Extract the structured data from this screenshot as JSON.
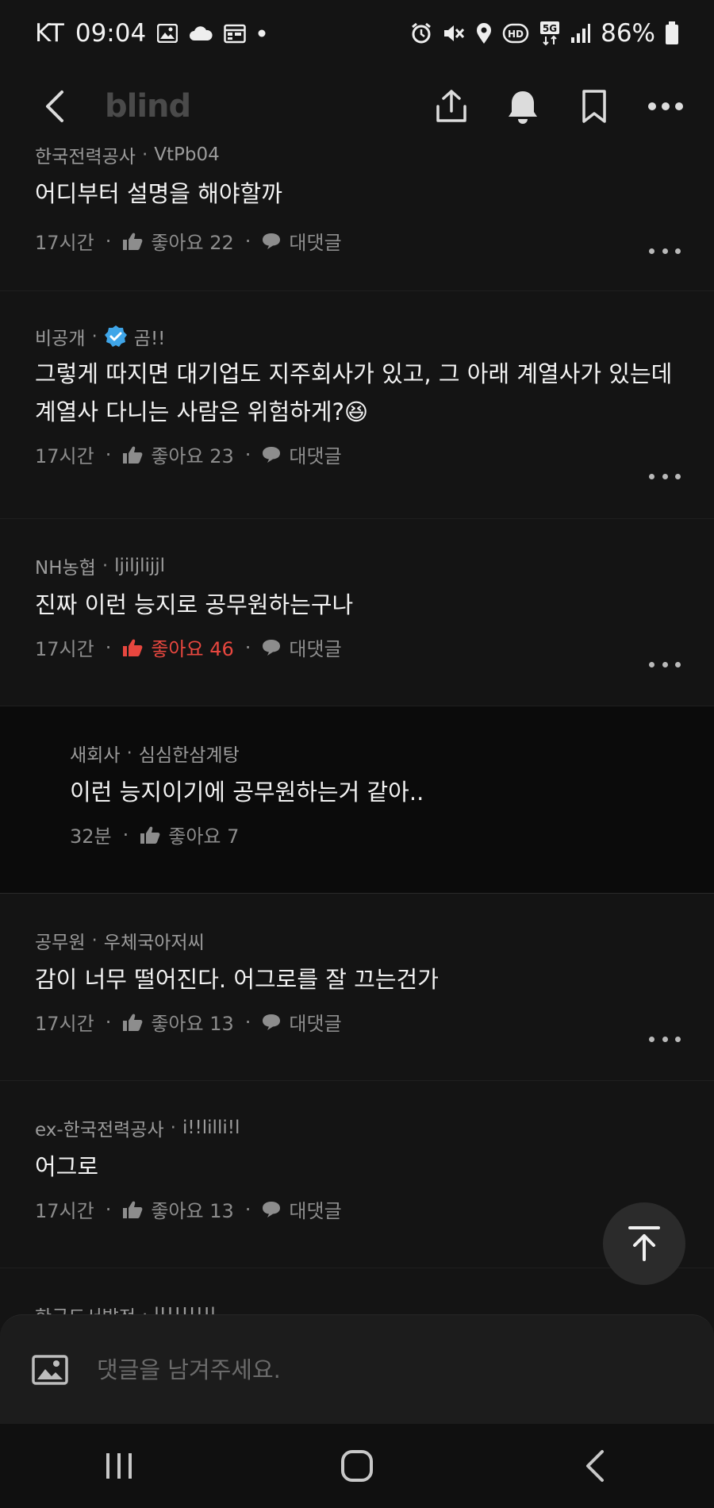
{
  "status": {
    "carrier": "KT",
    "time": "09:04",
    "network": "5G",
    "battery": "86%"
  },
  "header": {
    "logo": "blind"
  },
  "comments": [
    {
      "company": "한국전력공사",
      "nickname": "VtPb04",
      "text": "어디부터 설명을 해야할까",
      "time": "17시간",
      "like_label": "좋아요 22",
      "reply_label": "대댓글"
    },
    {
      "company": "비공개",
      "nickname": "곰!!",
      "text": "그렇게 따지면 대기업도 지주회사가 있고, 그 아래 계열사가 있는데 계열사 다니는 사람은 위험하게?😆",
      "time": "17시간",
      "like_label": "좋아요 23",
      "reply_label": "대댓글"
    },
    {
      "company": "NH농협",
      "nickname": "ljiljlijjl",
      "text": "진짜 이런 능지로 공무원하는구나",
      "time": "17시간",
      "like_label": "좋아요 46",
      "reply_label": "대댓글"
    },
    {
      "company": "새회사",
      "nickname": "심심한삼계탕",
      "text": "이런 능지이기에 공무원하는거 같아..",
      "time": "32분",
      "like_label": "좋아요 7"
    },
    {
      "company": "공무원",
      "nickname": "우체국아저씨",
      "text": "감이 너무 떨어진다. 어그로를 잘 끄는건가",
      "time": "17시간",
      "like_label": "좋아요 13",
      "reply_label": "대댓글"
    },
    {
      "company": "ex-한국전력공사",
      "nickname": "i!!lilli!l",
      "text": "어그로",
      "time": "17시간",
      "like_label": "좋아요 13",
      "reply_label": "대댓글"
    },
    {
      "company": "한국도서발전",
      "nickname": "l!!!!!!!l"
    }
  ],
  "input": {
    "placeholder": "댓글을 남겨주세요."
  },
  "colors": {
    "background": "#141414",
    "liked": "#e8473f",
    "verified": "#3fa5e8"
  }
}
